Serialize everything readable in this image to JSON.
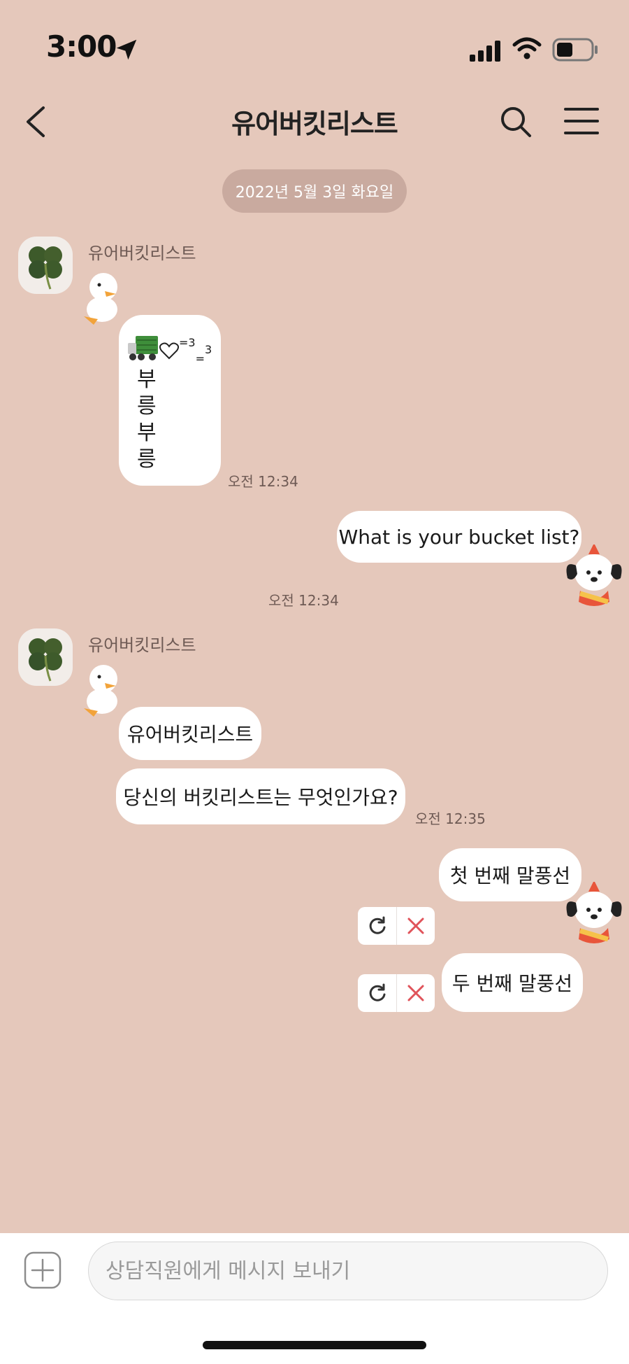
{
  "status_bar": {
    "time": "3:00"
  },
  "header": {
    "title": "유어버킷리스트"
  },
  "date_divider": "2022년 5월 3일 화요일",
  "messages": {
    "group1": {
      "sender": "유어버킷리스트",
      "emoticon_text": {
        "main": "=3",
        "sub": "=",
        "sup": "3"
      },
      "vertical_lines": [
        "부",
        "릉",
        "부",
        "릉"
      ],
      "time": "오전 12:34"
    },
    "mine1": {
      "text": "What is your bucket list?",
      "time": "오전 12:34"
    },
    "group2": {
      "sender": "유어버킷리스트",
      "bubble1": "유어버킷리스트",
      "bubble2": "당신의 버킷리스트는 무엇인가요?",
      "time": "오전 12:35"
    },
    "mine2": {
      "text1": "첫 번째 말풍선",
      "text2": "두 번째 말풍선"
    }
  },
  "input": {
    "placeholder": "상담직원에게 메시지 보내기"
  },
  "colors": {
    "background": "#e5c8bb",
    "date_pill": "#c9aa9f",
    "bubble": "#ffffff",
    "delete_x": "#e0535a"
  }
}
